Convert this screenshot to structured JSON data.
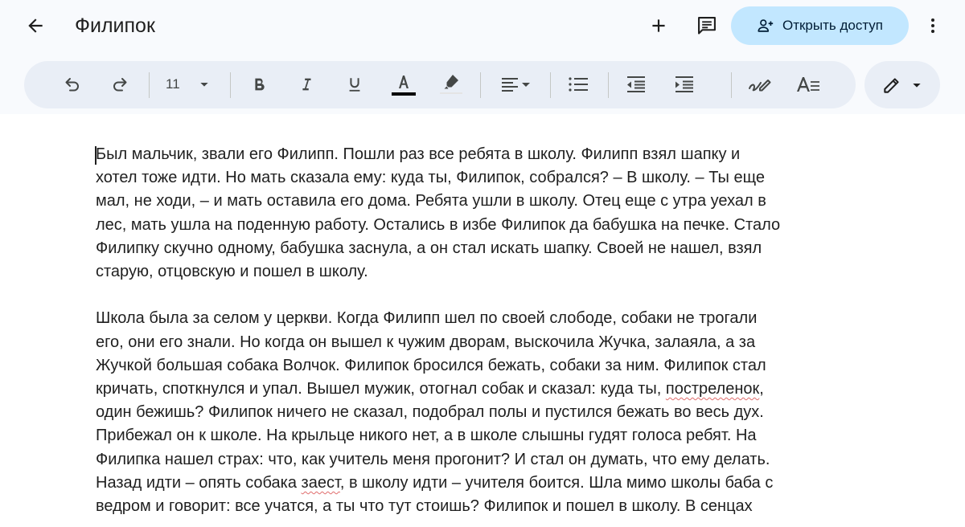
{
  "header": {
    "title": "Филипок",
    "share_label": "Открыть доступ",
    "icons": {
      "back": "arrow-back-icon",
      "new": "plus-icon",
      "comments": "comment-icon",
      "share": "person-add-icon",
      "more": "more-vert-icon"
    }
  },
  "toolbar": {
    "font_size": "11",
    "buttons": [
      "undo-icon",
      "redo-icon",
      "bold-icon",
      "italic-icon",
      "underline-icon",
      "text-color-icon",
      "highlight-icon",
      "align-icon",
      "bulleted-list-icon",
      "decrease-indent-icon",
      "increase-indent-icon",
      "handwriting-icon",
      "text-format-icon"
    ],
    "text_color": "#000000",
    "mode_icon": "pencil-icon"
  },
  "colors": {
    "accent": "#c2e7ff",
    "toolbar_bg": "#e9eef6",
    "chrome_bg": "#f8fafd",
    "spellcheck": "#e06c6c"
  },
  "document": {
    "paragraphs": [
      {
        "lines": [
          "Был мальчик, звали его Филипп. Пошли раз все ребята в школу. Филипп взял шапку и",
          "хотел тоже идти. Но мать сказала ему: куда ты, Филипок, собрался? – В школу. – Ты еще",
          "мал, не ходи, – и мать оставила его дома. Ребята ушли в школу. Отец еще с утра уехал в",
          "лес, мать ушла на поденную работу. Остались в избе Филипок да бабушка на печке. Стало",
          "Филипку скучно одному, бабушка заснула, а он стал искать шапку. Своей не нашел, взял",
          "старую, отцовскую и пошел в школу."
        ]
      },
      {
        "lines": [
          "Школа была за селом у церкви. Когда Филипп шел по своей слободе, собаки не трогали",
          "его, они его знали. Но когда он вышел к чужим дворам, выскочила Жучка, залаяла, а за",
          "Жучкой большая собака Волчок. Филипок бросился бежать, собаки за ним. Филипок стал",
          {
            "before": "кричать, споткнулся и упал. Вышел мужик, отогнал собак и сказал: куда ты, ",
            "flagged": "постреленок",
            "after": ","
          },
          "один бежишь? Филипок ничего не сказал, подобрал полы и пустился бежать во весь дух.",
          "Прибежал он к школе. На крыльце никого нет, а в школе слышны гудят голоса ребят. На",
          "Филипка нашел страх: что, как учитель меня прогонит? И стал он думать, что ему делать.",
          {
            "before": "Назад идти – опять собака ",
            "flagged": "заест",
            "after": ", в школу идти – учителя боится. Шла мимо школы баба с"
          },
          "ведром и говорит: все учатся, а ты что тут стоишь? Филипок и пошел в школу. В сенцах"
        ]
      }
    ]
  }
}
